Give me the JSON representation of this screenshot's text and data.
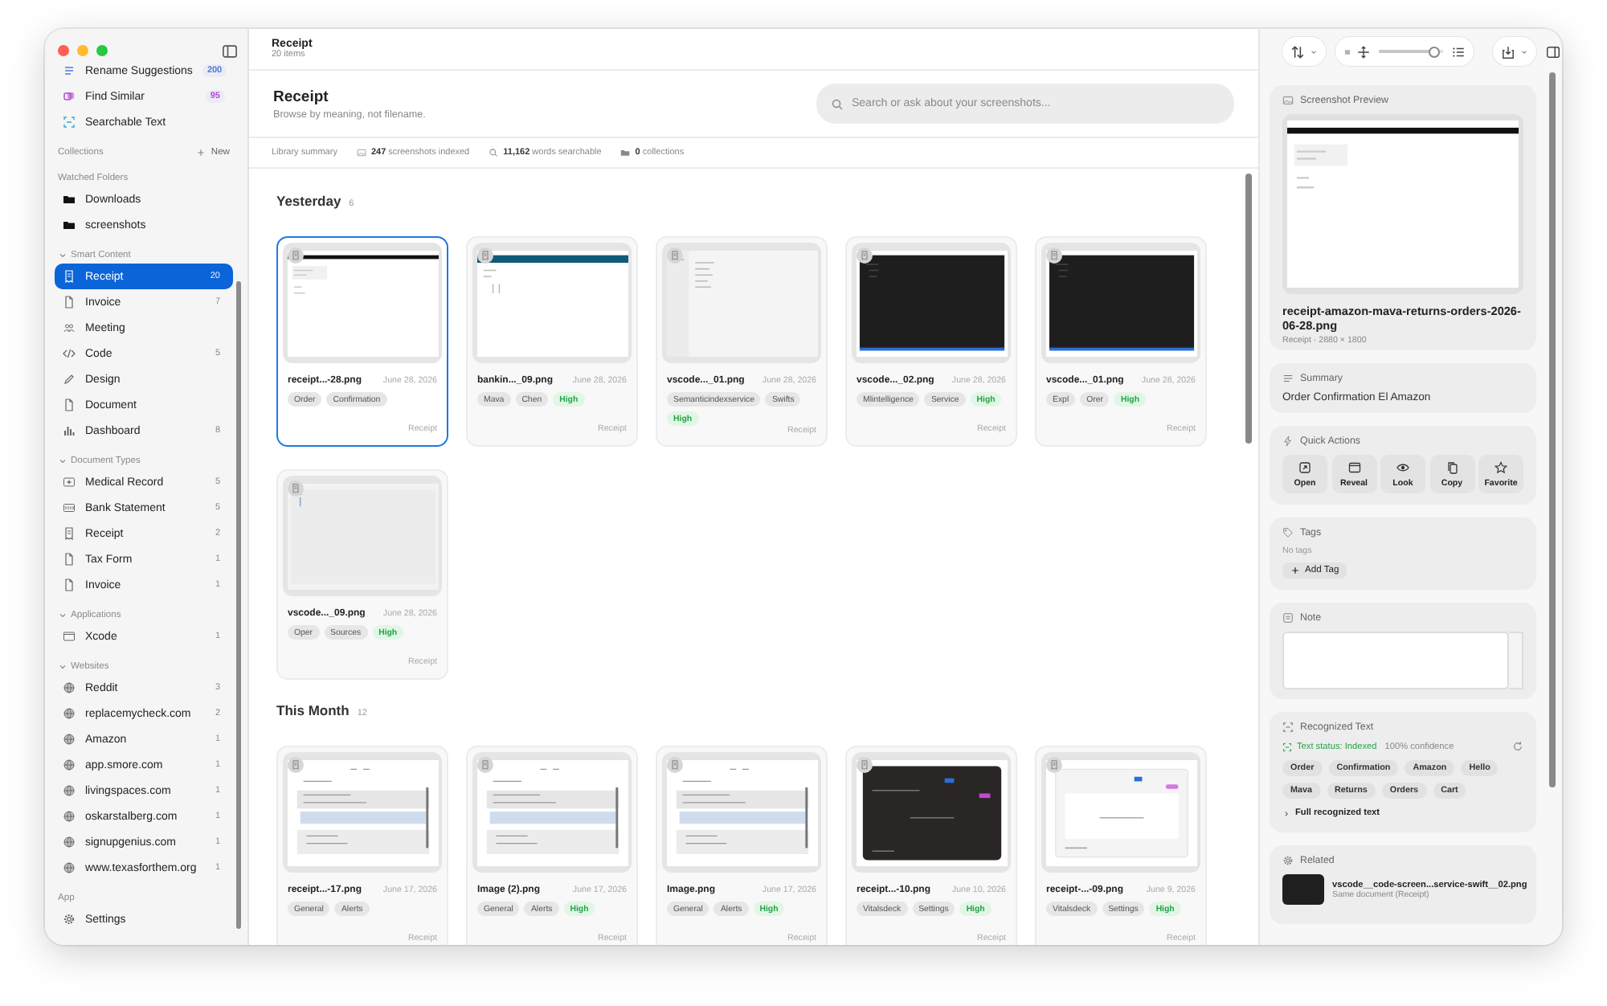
{
  "sidebar": {
    "sections": [
      {
        "items": [
          {
            "label": "Rename Suggestions",
            "count": "200",
            "color": "#4a7bd8",
            "selected": false
          },
          {
            "label": "Find Similar",
            "count": "95",
            "color": "#b04ad0",
            "selected": false
          },
          {
            "label": "Searchable Text",
            "selected": false
          }
        ]
      },
      {
        "title": "Collections",
        "action": "New"
      },
      {
        "title": "Watched Folders",
        "items": [
          {
            "label": "Downloads",
            "selected": false
          },
          {
            "label": "screenshots",
            "selected": false
          }
        ]
      },
      {
        "title": "Smart Content",
        "expanded": true,
        "items": [
          {
            "label": "Receipt",
            "count": "20",
            "selected": true
          },
          {
            "label": "Invoice",
            "count": "7",
            "selected": false
          },
          {
            "label": "Meeting",
            "selected": false
          },
          {
            "label": "Code",
            "count": "5",
            "selected": false
          },
          {
            "label": "Design",
            "selected": false
          },
          {
            "label": "Document",
            "selected": false
          },
          {
            "label": "Dashboard",
            "count": "8",
            "selected": false
          }
        ]
      },
      {
        "title": "Document Types",
        "expanded": true,
        "items": [
          {
            "label": "Medical Record",
            "count": "5",
            "selected": false
          },
          {
            "label": "Bank Statement",
            "count": "5",
            "selected": false
          },
          {
            "label": "Receipt",
            "count": "2",
            "selected": false
          },
          {
            "label": "Tax Form",
            "count": "1",
            "selected": false
          },
          {
            "label": "Invoice",
            "count": "1",
            "selected": false
          }
        ]
      },
      {
        "title": "Applications",
        "expanded": true,
        "items": [
          {
            "label": "Xcode",
            "count": "1",
            "selected": false
          }
        ]
      },
      {
        "title": "Websites",
        "expanded": true,
        "items": [
          {
            "label": "Reddit",
            "count": "3",
            "selected": false
          },
          {
            "label": "replacemycheck.com",
            "count": "2",
            "selected": false
          },
          {
            "label": "Amazon",
            "count": "1",
            "selected": false
          },
          {
            "label": "app.smore.com",
            "count": "1",
            "selected": false
          },
          {
            "label": "livingspaces.com",
            "count": "1",
            "selected": false
          },
          {
            "label": "oskarstalberg.com",
            "count": "1",
            "selected": false
          },
          {
            "label": "signupgenius.com",
            "count": "1",
            "selected": false
          },
          {
            "label": "www.texasforthem.org",
            "count": "1",
            "selected": false
          }
        ]
      },
      {
        "title": "App",
        "items": [
          {
            "label": "Settings",
            "selected": false
          }
        ]
      }
    ]
  },
  "header": {
    "title": "Receipt",
    "subtitle": "20 items"
  },
  "hero": {
    "title": "Receipt",
    "subtitle": "Browse by meaning, not filename."
  },
  "search": {
    "placeholder": "Search or ask about your screenshots..."
  },
  "summary": {
    "label": "Library summary",
    "stats": [
      "**247** screenshots indexed",
      "**11,162** words searchable",
      "**0** collections"
    ]
  },
  "groups": [
    {
      "title": "Yesterday",
      "count": "6",
      "cards": [
        {
          "name": "receipt...-28.png",
          "date": "June 28, 2026",
          "tags": [
            "Order",
            "Confirmation"
          ],
          "category": "Receipt",
          "selected": true,
          "kind": "light-page"
        },
        {
          "name": "bankin..._09.png",
          "date": "June 28, 2026",
          "tags": [
            "Mava",
            "Chen"
          ],
          "confidence": "High",
          "category": "Receipt",
          "selected": false,
          "kind": "banner"
        },
        {
          "name": "vscode..._01.png",
          "date": "June 28, 2026",
          "tags": [
            "Semanticindexservice",
            "Swifts"
          ],
          "confidence": "High",
          "category": "Receipt",
          "selected": false,
          "kind": "light-sidebar"
        },
        {
          "name": "vscode..._02.png",
          "date": "June 28, 2026",
          "tags": [
            "Mlintelligence",
            "Service"
          ],
          "confidence": "High",
          "category": "Receipt",
          "selected": false,
          "kind": "dark-editor"
        },
        {
          "name": "vscode..._01.png",
          "date": "June 28, 2026",
          "tags": [
            "Expl",
            "Orer"
          ],
          "confidence": "High",
          "category": "Receipt",
          "selected": false,
          "kind": "dark-editor"
        },
        {
          "name": "vscode..._09.png",
          "date": "June 28, 2026",
          "tags": [
            "Oper",
            "Sources"
          ],
          "confidence": "High",
          "category": "Receipt",
          "selected": false,
          "kind": "blank"
        }
      ]
    },
    {
      "title": "This Month",
      "count": "12",
      "cards": [
        {
          "name": "receipt...-17.png",
          "date": "June 17, 2026",
          "tags": [
            "General",
            "Alerts"
          ],
          "category": "Receipt",
          "selected": false,
          "kind": "form"
        },
        {
          "name": "Image (2).png",
          "date": "June 17, 2026",
          "tags": [
            "General",
            "Alerts"
          ],
          "confidence": "High",
          "category": "Receipt",
          "selected": false,
          "kind": "form"
        },
        {
          "name": "Image.png",
          "date": "June 17, 2026",
          "tags": [
            "General",
            "Alerts"
          ],
          "confidence": "High",
          "category": "Receipt",
          "selected": false,
          "kind": "form"
        },
        {
          "name": "receipt...-10.png",
          "date": "June 10, 2026",
          "tags": [
            "Vitalsdeck",
            "Settings"
          ],
          "confidence": "High",
          "category": "Receipt",
          "selected": false,
          "kind": "dark-dialog"
        },
        {
          "name": "receipt-...-09.png",
          "date": "June 9, 2026",
          "tags": [
            "Vitalsdeck",
            "Settings"
          ],
          "confidence": "High",
          "category": "Receipt",
          "selected": false,
          "kind": "light-dialog"
        }
      ]
    }
  ],
  "inspector": {
    "slider": {
      "level": 0.95
    },
    "preview": {
      "title": "Screenshot Preview",
      "filename": "receipt-amazon-mava-returns-orders-2026-06-28.png",
      "meta": "Receipt · 2880 × 1800"
    },
    "summary": {
      "title": "Summary",
      "text": "Order Confirmation El Amazon"
    },
    "quick_actions": {
      "title": "Quick Actions",
      "buttons": [
        "Open",
        "Reveal",
        "Look",
        "Copy",
        "Favorite"
      ]
    },
    "tags": {
      "title": "Tags",
      "empty_text": "No tags",
      "add_button": "Add Tag"
    },
    "note": {
      "title": "Note"
    },
    "recognized_text": {
      "title": "Recognized Text",
      "status": "Text status: Indexed",
      "confidence": "100% confidence",
      "words": [
        "Order",
        "Confirmation",
        "Amazon",
        "Hello",
        "Mava",
        "Returns",
        "Orders",
        "Cart"
      ],
      "disclosure": "Full recognized text",
      "expanded": false
    },
    "related": {
      "title": "Related",
      "items": [
        {
          "name": "vscode__code-screen...service-swift__02.png",
          "detail": "Same document (Receipt)"
        }
      ]
    }
  }
}
